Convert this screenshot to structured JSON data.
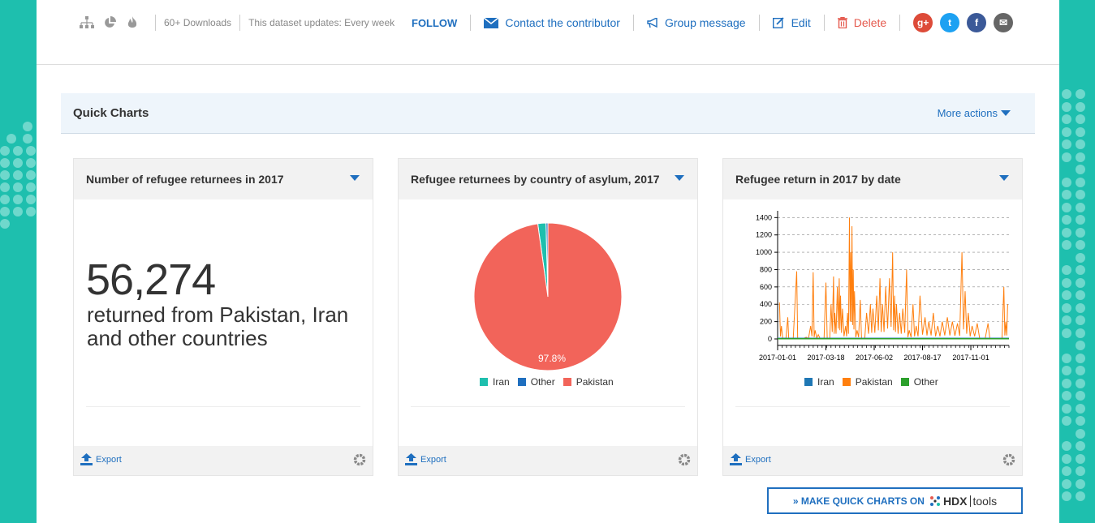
{
  "meta": {
    "downloads": "60+ Downloads",
    "updates": "This dataset updates: Every week"
  },
  "actions": {
    "follow": "FOLLOW",
    "contact": "Contact the contributor",
    "group": "Group message",
    "edit": "Edit",
    "delete": "Delete"
  },
  "social": {
    "gplus": "g+",
    "twitter": "t",
    "facebook": "f",
    "email": "✉"
  },
  "quick_charts": {
    "title": "Quick Charts",
    "more_actions": "More actions"
  },
  "cards": [
    {
      "title": "Number of refugee returnees in 2017",
      "big_number": "56,274",
      "subtitle": "returned from Pakistan, Iran and other countries",
      "export": "Export"
    },
    {
      "title": "Refugee returnees by country of asylum, 2017",
      "export": "Export",
      "pie_label": "97.8%"
    },
    {
      "title": "Refugee return in 2017 by date",
      "export": "Export"
    }
  ],
  "hdx_button": {
    "label": "» MAKE QUICK CHARTS ON",
    "logo": "HDX",
    "tools": "tools"
  },
  "colors": {
    "iran": "#1ebfae",
    "other_pie": "#1f6fbf",
    "pakistan_pie": "#f2645a",
    "iran_line": "#1f77b4",
    "pakistan_line": "#ff7f0e",
    "other_line": "#2ca02c"
  },
  "chart_data": [
    {
      "type": "pie",
      "title": "Refugee returnees by country of asylum, 2017",
      "slices": [
        {
          "name": "Iran",
          "value": 1.8
        },
        {
          "name": "Other",
          "value": 0.4
        },
        {
          "name": "Pakistan",
          "value": 97.8
        }
      ],
      "legend": [
        "Iran",
        "Other",
        "Pakistan"
      ],
      "legend_position": "bottom"
    },
    {
      "type": "line",
      "title": "Refugee return in 2017 by date",
      "x_tick_labels": [
        "2017-01-01",
        "2017-03-18",
        "2017-06-02",
        "2017-08-17",
        "2017-11-01"
      ],
      "y_ticks": [
        0,
        200,
        400,
        600,
        800,
        1000,
        1200,
        1400
      ],
      "ylim": [
        0,
        1450
      ],
      "xlim": [
        "2017-01-01",
        "2017-12-31"
      ],
      "grid": true,
      "legend": [
        "Iran",
        "Pakistan",
        "Other"
      ],
      "legend_position": "bottom",
      "series": [
        {
          "name": "Iran",
          "values": [
            [
              0,
              0
            ],
            [
              100,
              0
            ],
            [
              150,
              10
            ],
            [
              200,
              0
            ],
            [
              300,
              5
            ],
            [
              363,
              0
            ]
          ]
        },
        {
          "name": "Pakistan",
          "values": [
            [
              0,
              0
            ],
            [
              3,
              420
            ],
            [
              6,
              150
            ],
            [
              9,
              0
            ],
            [
              12,
              0
            ],
            [
              17,
              0
            ],
            [
              20,
              0
            ],
            [
              24,
              0
            ],
            [
              27,
              0
            ],
            [
              30,
              0
            ],
            [
              33,
              0
            ],
            [
              36,
              0
            ],
            [
              39,
              0
            ],
            [
              42,
              0
            ],
            [
              45,
              0
            ],
            [
              48,
              0
            ],
            [
              51,
              0
            ],
            [
              54,
              0
            ],
            [
              57,
              0
            ],
            [
              60,
              0
            ],
            [
              63,
              0
            ],
            [
              66,
              0
            ],
            [
              69,
              0
            ],
            [
              72,
              0
            ],
            [
              75,
              0
            ],
            [
              78,
              0
            ],
            [
              81,
              0
            ],
            [
              84,
              0
            ],
            [
              87,
              0
            ],
            [
              90,
              0
            ],
            [
              93,
              0
            ],
            [
              96,
              0
            ],
            [
              99,
              0
            ],
            [
              102,
              0
            ],
            [
              105,
              0
            ],
            [
              108,
              0
            ],
            [
              111,
              0
            ],
            [
              114,
              0
            ],
            [
              117,
              0
            ],
            [
              120,
              0
            ],
            [
              123,
              0
            ],
            [
              126,
              0
            ],
            [
              129,
              0
            ],
            [
              132,
              0
            ],
            [
              135,
              0
            ],
            [
              138,
              0
            ],
            [
              141,
              0
            ],
            [
              144,
              0
            ],
            [
              147,
              0
            ],
            [
              150,
              0
            ],
            [
              153,
              0
            ],
            [
              156,
              0
            ],
            [
              159,
              0
            ],
            [
              162,
              0
            ],
            [
              165,
              0
            ],
            [
              168,
              0
            ],
            [
              171,
              0
            ],
            [
              174,
              0
            ],
            [
              177,
              0
            ],
            [
              180,
              0
            ],
            [
              183,
              0
            ],
            [
              186,
              0
            ],
            [
              189,
              0
            ],
            [
              192,
              0
            ],
            [
              195,
              0
            ],
            [
              198,
              0
            ],
            [
              201,
              0
            ],
            [
              204,
              0
            ],
            [
              207,
              0
            ],
            [
              210,
              0
            ],
            [
              213,
              0
            ],
            [
              216,
              0
            ],
            [
              219,
              0
            ],
            [
              222,
              0
            ],
            [
              225,
              0
            ],
            [
              228,
              0
            ],
            [
              231,
              0
            ],
            [
              234,
              0
            ],
            [
              237,
              0
            ],
            [
              240,
              0
            ],
            [
              243,
              0
            ],
            [
              246,
              0
            ],
            [
              249,
              0
            ],
            [
              252,
              0
            ],
            [
              255,
              0
            ],
            [
              258,
              0
            ],
            [
              261,
              0
            ],
            [
              264,
              0
            ],
            [
              267,
              0
            ],
            [
              270,
              0
            ],
            [
              273,
              0
            ],
            [
              276,
              0
            ],
            [
              279,
              0
            ],
            [
              282,
              0
            ],
            [
              285,
              0
            ],
            [
              288,
              0
            ],
            [
              291,
              0
            ],
            [
              294,
              0
            ],
            [
              297,
              0
            ],
            [
              300,
              0
            ],
            [
              303,
              0
            ],
            [
              306,
              0
            ],
            [
              309,
              0
            ],
            [
              312,
              0
            ],
            [
              315,
              0
            ],
            [
              318,
              0
            ],
            [
              321,
              0
            ],
            [
              324,
              0
            ],
            [
              327,
              0
            ],
            [
              330,
              0
            ],
            [
              333,
              0
            ],
            [
              336,
              0
            ],
            [
              339,
              0
            ],
            [
              342,
              0
            ],
            [
              345,
              0
            ],
            [
              348,
              0
            ],
            [
              351,
              0
            ],
            [
              354,
              0
            ],
            [
              357,
              0
            ],
            [
              360,
              0
            ],
            [
              363,
              0
            ]
          ]
        },
        {
          "name": "Other",
          "values": [
            [
              0,
              0
            ],
            [
              363,
              0
            ]
          ]
        }
      ]
    }
  ]
}
